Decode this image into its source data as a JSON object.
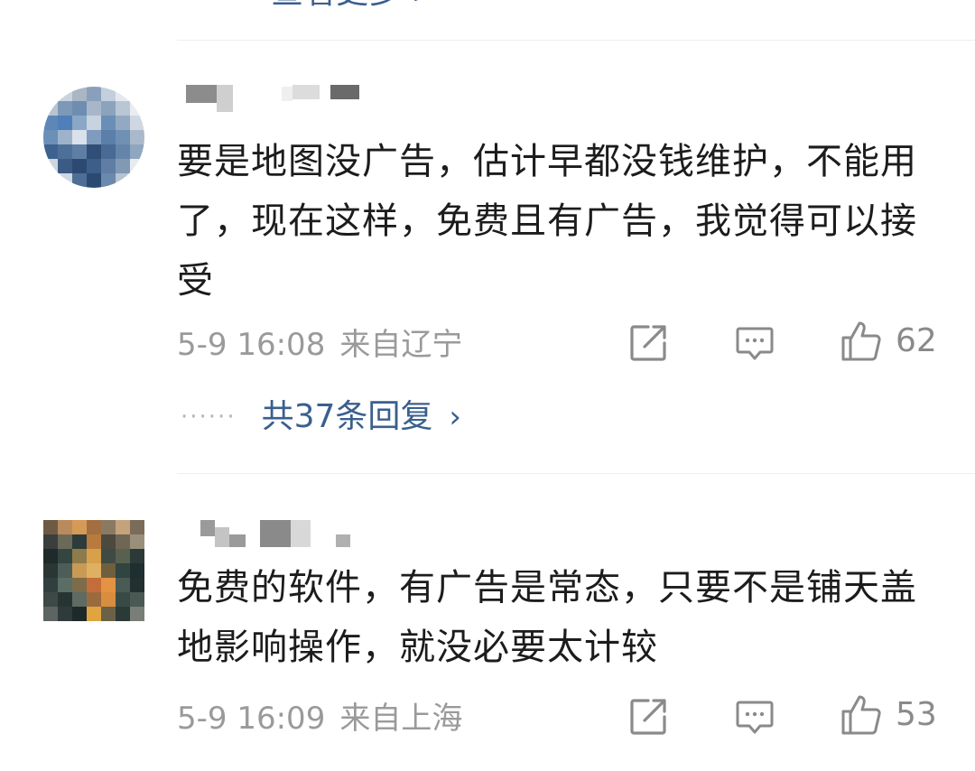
{
  "previous": {
    "view_more": "查看更多 >"
  },
  "comments": [
    {
      "text": "要是地图没广告，估计早都没钱维护，不能用了，现在这样，免费且有广告，我觉得可以接受",
      "time": "5-9 16:08",
      "location": "来自辽宁",
      "likes": "62",
      "replies_label": "共37条回复",
      "replies_chevron": "›",
      "replies_dots": "······"
    },
    {
      "text": "免费的软件，有广告是常态，只要不是铺天盖地影响操作，就没必要太计较",
      "time": "5-9 16:09",
      "location": "来自上海",
      "likes": "53"
    }
  ],
  "colors": {
    "link": "#3a5f8e",
    "meta": "#9a9a9a",
    "divider": "#eeeeee"
  },
  "icons": [
    "share-icon",
    "comment-icon",
    "like-icon"
  ]
}
